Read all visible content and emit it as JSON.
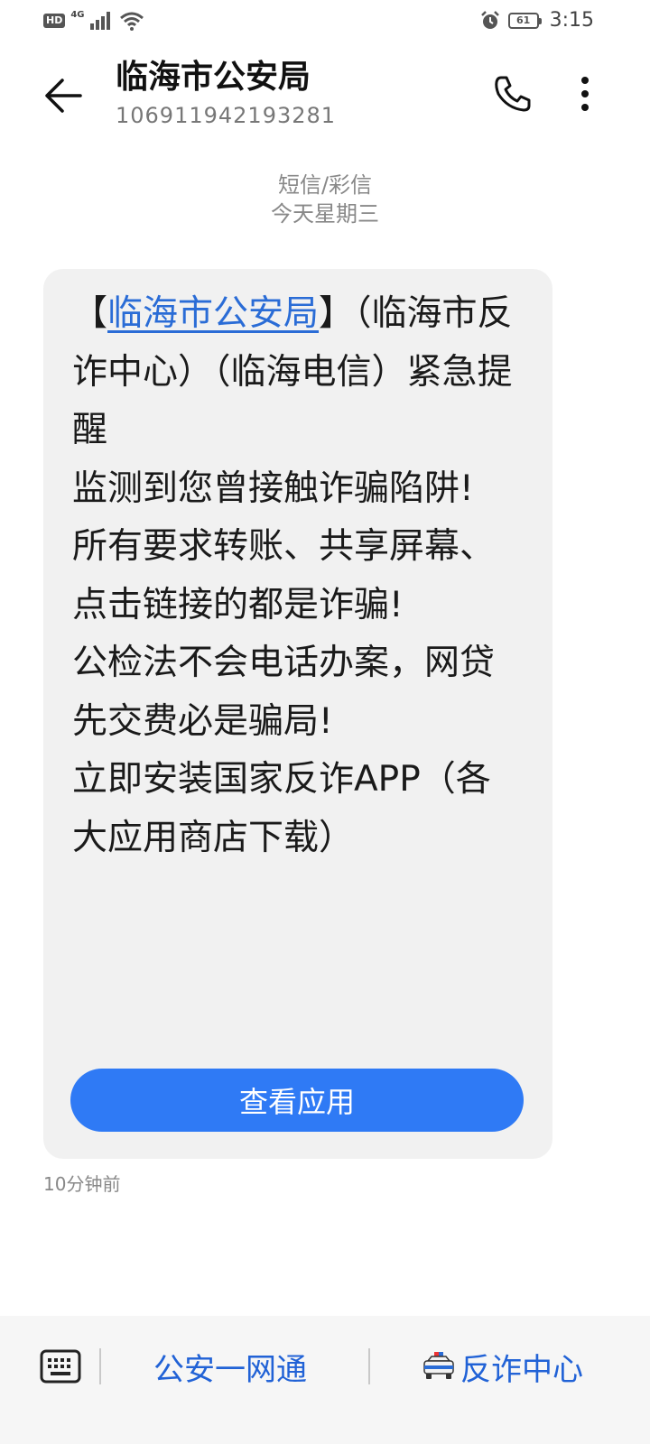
{
  "status_bar": {
    "hd_badge": "HD",
    "network_type": "4G",
    "battery_level": "61",
    "time": "3:15",
    "icons": [
      "signal-icon",
      "wifi-icon",
      "alarm-icon",
      "battery-icon"
    ]
  },
  "header": {
    "contact_name": "临海市公安局",
    "contact_number": "106911942193281",
    "icons": [
      "back-arrow-icon",
      "phone-icon",
      "more-vertical-icon"
    ]
  },
  "meta": {
    "message_type": "短信/彩信",
    "date_label": "今天星期三"
  },
  "message": {
    "bracket_open": "【",
    "sender_link": "临海市公安局",
    "body": "】（临海市反诈中心）（临海电信）紧急提醒\n监测到您曾接触诈骗陷阱!\n所有要求转账、共享屏幕、点击链接的都是诈骗!\n公检法不会电话办案，网贷先交费必是骗局!\n立即安装国家反诈APP（各大应用商店下载）",
    "button_label": "查看应用",
    "timestamp": "10分钟前"
  },
  "bottom_bar": {
    "item1_label": "公安一网通",
    "item2_label": "反诈中心",
    "icons": [
      "keyboard-icon",
      "police-car-icon"
    ]
  },
  "colors": {
    "link": "#2a6cd6",
    "button": "#2f7af5",
    "bottom_link": "#2162d6",
    "bubble": "#f1f1f1"
  }
}
